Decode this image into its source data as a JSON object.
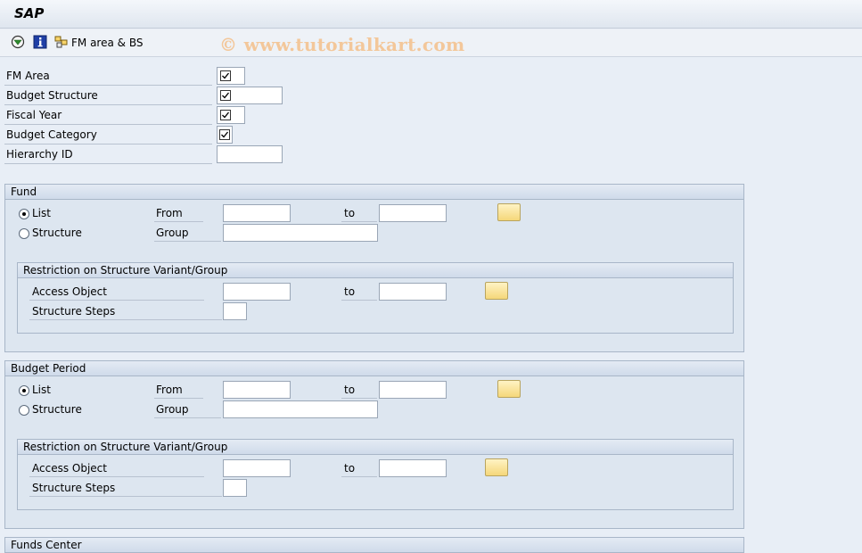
{
  "window": {
    "title": "SAP"
  },
  "toolbar": {
    "execute_icon": "execute-icon",
    "info_icon": "info-icon",
    "fm_area_bs_label": "FM area & BS"
  },
  "watermark": "© www.tutorialkart.com",
  "header_fields": [
    {
      "label": "FM Area",
      "checked": true
    },
    {
      "label": "Budget Structure",
      "checked": true
    },
    {
      "label": "Fiscal Year",
      "checked": true
    },
    {
      "label": "Budget Category",
      "checked": true
    },
    {
      "label": "Hierarchy ID",
      "checked": false
    }
  ],
  "fund": {
    "title": "Fund",
    "list_label": "List",
    "structure_label": "Structure",
    "from_label": "From",
    "to_label": "to",
    "group_label": "Group",
    "selected": "List",
    "restriction": {
      "title": "Restriction on Structure Variant/Group",
      "access_object_label": "Access Object",
      "to_label": "to",
      "structure_steps_label": "Structure Steps"
    }
  },
  "budget_period": {
    "title": "Budget Period",
    "list_label": "List",
    "structure_label": "Structure",
    "from_label": "From",
    "to_label": "to",
    "group_label": "Group",
    "selected": "List",
    "restriction": {
      "title": "Restriction on Structure Variant/Group",
      "access_object_label": "Access Object",
      "to_label": "to",
      "structure_steps_label": "Structure Steps"
    }
  },
  "funds_center": {
    "title": "Funds Center"
  }
}
